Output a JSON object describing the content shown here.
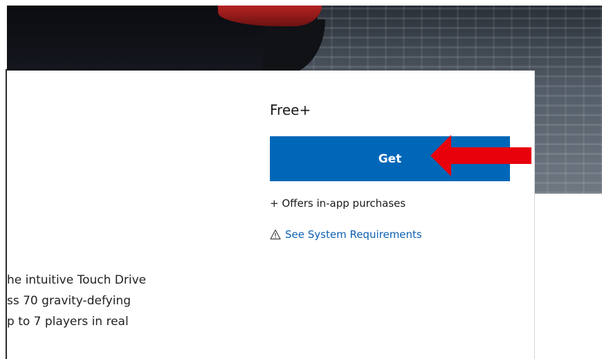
{
  "product": {
    "price": "Free+",
    "get_label": "Get",
    "offers_text": "+ Offers in-app purchases",
    "system_requirements_link": "See System Requirements",
    "description_lines": [
      "he intuitive Touch Drive",
      "ss 70 gravity-defying",
      "p to 7 players in real"
    ]
  },
  "icons": {
    "warning": "warning-triangle-icon",
    "annotation": "red-arrow-icon"
  },
  "colors": {
    "button": "#0067b8",
    "link": "#0b5fb3",
    "arrow": "#e8000b"
  }
}
